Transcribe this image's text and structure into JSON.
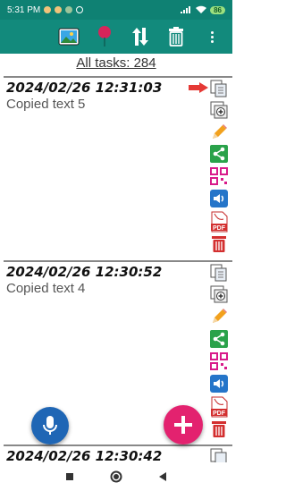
{
  "status": {
    "time": "5:31 PM",
    "battery": "86"
  },
  "summary": {
    "total_label": "All tasks: 284"
  },
  "tasks": [
    {
      "date": "2024/02/26 12:31:03",
      "text": "Copied text 5"
    },
    {
      "date": "2024/02/26 12:30:52",
      "text": "Copied text 4"
    },
    {
      "date": "2024/02/26 12:30:42"
    }
  ],
  "icons": {
    "pdf_label": "PDF"
  },
  "colors": {
    "app_bar": "#128a7c",
    "status_bar": "#0f8173",
    "fab_add": "#e3226f",
    "fab_mic": "#1f66b5",
    "share": "#2aa24a",
    "delete": "#d32f2f",
    "speaker": "#2575c9"
  }
}
